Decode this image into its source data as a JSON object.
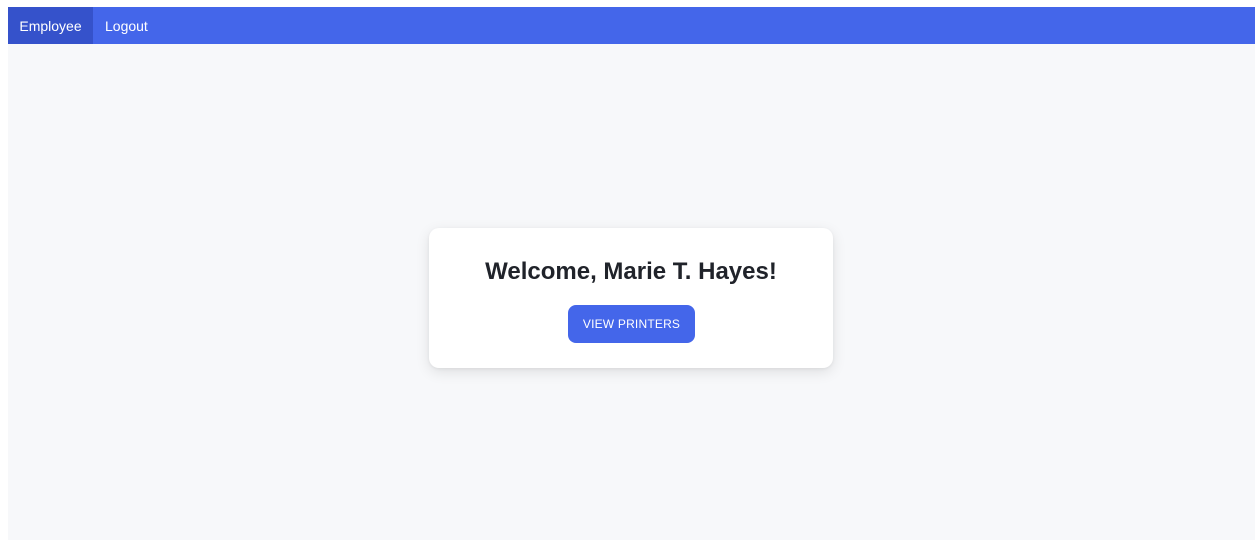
{
  "navbar": {
    "items": [
      {
        "label": "Employee",
        "active": true
      },
      {
        "label": "Logout",
        "active": false
      }
    ]
  },
  "card": {
    "title": "Welcome, Marie T. Hayes!",
    "button_label": "VIEW PRINTERS"
  },
  "colors": {
    "accent": "#4466ea",
    "active_nav": "#3552cb",
    "page_background": "#f7f8fa"
  }
}
